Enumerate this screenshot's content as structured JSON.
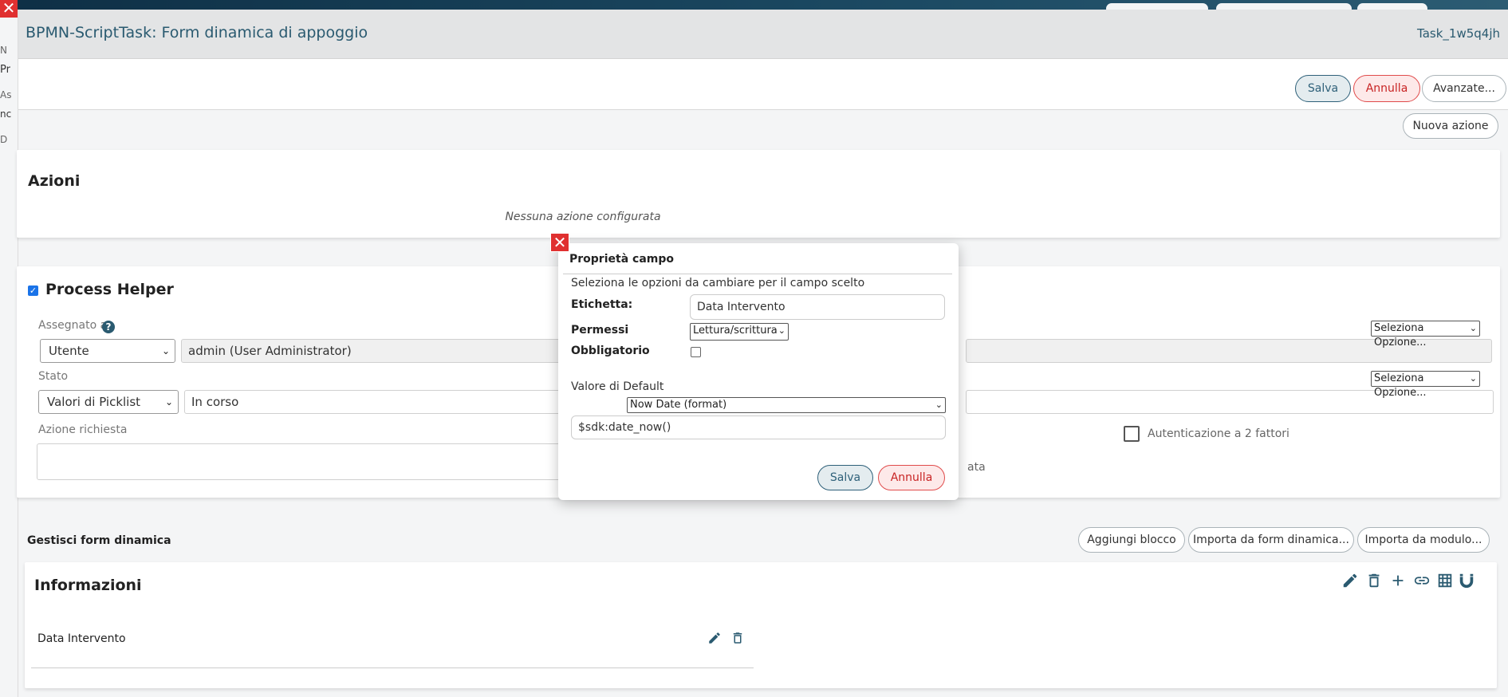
{
  "panel": {
    "title": "BPMN-ScriptTask: Form dinamica di appoggio",
    "task_id": "Task_1w5q4jh"
  },
  "toolbar": {
    "save_label": "Salva",
    "cancel_label": "Annulla",
    "advanced_label": "Avanzate..."
  },
  "new_action_label": "Nuova azione",
  "actions_card": {
    "title": "Azioni",
    "empty_text": "Nessuna azione configurata"
  },
  "process_helper": {
    "title": "Process Helper",
    "assigned_label": "Assegnato a",
    "assigned_type": "Utente",
    "assigned_value": "admin (User Administrator)",
    "status_label": "Stato",
    "status_type": "Valori di Picklist",
    "status_value": "In corso",
    "action_label": "Azione richiesta",
    "select_option_1": "Seleziona Opzione...",
    "select_option_2": "Seleziona Opzione...",
    "two_factor_label": "Autenticazione a 2 fattori",
    "partial_text": "ata"
  },
  "dynamic_form": {
    "title": "Gestisci form dinamica",
    "add_block_label": "Aggiungi blocco",
    "import_form_label": "Importa da form dinamica...",
    "import_module_label": "Importa da modulo...",
    "block_title": "Informazioni",
    "field_name": "Data Intervento"
  },
  "modal": {
    "title": "Proprietà campo",
    "subtitle": "Seleziona le opzioni da cambiare per il campo scelto",
    "label_label": "Etichetta:",
    "label_value": "Data Intervento",
    "permissions_label": "Permessi",
    "permissions_value": "Lettura/scrittura",
    "mandatory_label": "Obbligatorio",
    "default_label": "Valore di Default",
    "default_type": "Now Date (format)",
    "default_value": "$sdk:date_now()",
    "save_label": "Salva",
    "cancel_label": "Annulla"
  },
  "background": {
    "left_letters": [
      "N",
      "Pr",
      "As",
      "nc",
      "D"
    ]
  },
  "colors": {
    "accent": "#2a5a70",
    "danger": "#e03030",
    "cancel_bg": "#fde9e9"
  }
}
